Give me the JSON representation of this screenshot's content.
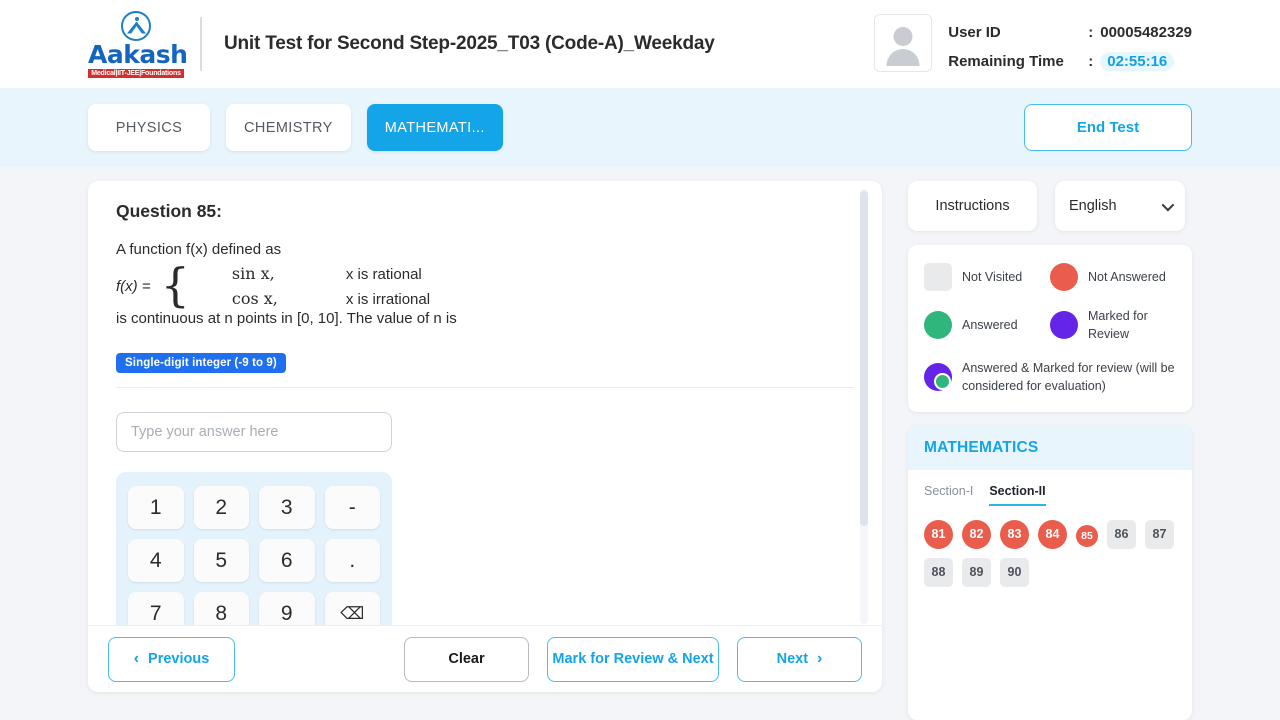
{
  "header": {
    "logo_word": "Aakash",
    "logo_sub": "Medical|IIT-JEE|Foundations",
    "title": "Unit Test for Second Step-2025_T03 (Code-A)_Weekday",
    "user_id_label": "User ID",
    "user_id_value": "00005482329",
    "remaining_time_label": "Remaining Time",
    "remaining_time_value": "02:55:16",
    "colon": ":"
  },
  "tabbar": {
    "tabs": [
      {
        "label": "PHYSICS",
        "active": false
      },
      {
        "label": "CHEMISTRY",
        "active": false
      },
      {
        "label": "MATHEMATI...",
        "active": true
      }
    ],
    "end_test_label": "End Test"
  },
  "question": {
    "title": "Question 85:",
    "intro": "A function f(x) defined as",
    "piecewise_lhs": "f(x) =",
    "rows": [
      {
        "expr": "sin x,",
        "cond": "x is rational"
      },
      {
        "expr": "cos x,",
        "cond": "x is irrational"
      }
    ],
    "tail": "is continuous at n points in [0, 10]. The value of n is",
    "badge": "Single-digit integer (-9 to 9)",
    "answer_value": "",
    "answer_placeholder": "Type your answer here",
    "keypad": [
      "1",
      "2",
      "3",
      "-",
      "4",
      "5",
      "6",
      ".",
      "7",
      "8",
      "9",
      "⌫"
    ]
  },
  "footer": {
    "previous_label": "Previous",
    "previous_chevron": "‹",
    "clear_label": "Clear",
    "mark_review_label": "Mark for Review & Next",
    "next_label": "Next",
    "next_chevron": "›"
  },
  "sidebar": {
    "instructions_label": "Instructions",
    "language_value": "English",
    "legend": [
      {
        "label": "Not Visited",
        "style": "square",
        "color": "#e8eaec"
      },
      {
        "label": "Not Answered",
        "style": "circle",
        "color": "#ea5c4c"
      },
      {
        "label": "Answered",
        "style": "circle",
        "color": "#2fb67c"
      },
      {
        "label": "Marked for Review",
        "style": "circle",
        "color": "#6425e8"
      },
      {
        "label": "Answered & Marked for review (will be considered for evaluation)",
        "style": "combo",
        "color": "#6425e8"
      }
    ],
    "palette_title": "MATHEMATICS",
    "sections": [
      {
        "label": "Section-I",
        "active": false
      },
      {
        "label": "Section-II",
        "active": true
      }
    ],
    "questions": [
      {
        "num": "81",
        "state": "notanswered"
      },
      {
        "num": "82",
        "state": "notanswered"
      },
      {
        "num": "83",
        "state": "notanswered"
      },
      {
        "num": "84",
        "state": "notanswered"
      },
      {
        "num": "85",
        "state": "current"
      },
      {
        "num": "86",
        "state": "notvisited"
      },
      {
        "num": "87",
        "state": "notvisited"
      },
      {
        "num": "88",
        "state": "notvisited"
      },
      {
        "num": "89",
        "state": "notvisited"
      },
      {
        "num": "90",
        "state": "notvisited"
      }
    ]
  }
}
